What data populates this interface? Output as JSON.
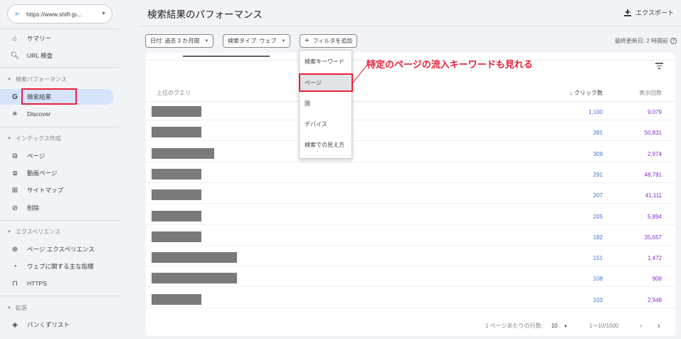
{
  "sidebar": {
    "property": "https://www.shift-jp...",
    "items": [
      {
        "label": "サマリー",
        "icon": "home-icon"
      },
      {
        "label": "URL 検査",
        "icon": "search-icon"
      },
      {
        "label": "検索結果",
        "icon": "google-g-icon"
      },
      {
        "label": "Discover",
        "icon": "asterisk-icon"
      },
      {
        "label": "ページ",
        "icon": "pages-icon"
      },
      {
        "label": "動画ページ",
        "icon": "video-pages-icon"
      },
      {
        "label": "サイトマップ",
        "icon": "sitemap-icon"
      },
      {
        "label": "削除",
        "icon": "eye-off-icon"
      },
      {
        "label": "ページ エクスペリエンス",
        "icon": "plus-circle-icon"
      },
      {
        "label": "ウェブに関する主な指標",
        "icon": "gauge-icon"
      },
      {
        "label": "HTTPS",
        "icon": "lock-icon"
      },
      {
        "label": "パンくずリスト",
        "icon": "diamond-icon"
      }
    ],
    "sections": [
      "検索パフォーマンス",
      "インデックス作成",
      "エクスペリエンス",
      "拡張"
    ]
  },
  "header": {
    "title": "検索結果のパフォーマンス",
    "export": "エクスポート"
  },
  "filters": {
    "date": "日付: 過去 3 か月間",
    "search_type": "検索タイプ: ウェブ",
    "add_filter": "フィルタを追加",
    "last_updated": "最終更新日: 2 時間前"
  },
  "dropdown": {
    "items": [
      "検索キーワード",
      "ページ",
      "国",
      "デバイス",
      "検索での見え方"
    ]
  },
  "annotation": "特定のページの流入キーワードも見れる",
  "table": {
    "columns": {
      "query": "上位のクエリ",
      "clicks": "クリック数",
      "impressions": "表示回数"
    },
    "rows": [
      {
        "clicks": "1,100",
        "impressions": "9,079"
      },
      {
        "clicks": "391",
        "impressions": "50,831"
      },
      {
        "clicks": "309",
        "impressions": "2,974"
      },
      {
        "clicks": "291",
        "impressions": "48,781"
      },
      {
        "clicks": "207",
        "impressions": "41,111"
      },
      {
        "clicks": "205",
        "impressions": "5,894"
      },
      {
        "clicks": "182",
        "impressions": "35,657"
      },
      {
        "clicks": "151",
        "impressions": "1,472"
      },
      {
        "clicks": "108",
        "impressions": "908"
      },
      {
        "clicks": "103",
        "impressions": "2,948"
      }
    ]
  },
  "pagination": {
    "rows_label": "1 ページあたりの行数:",
    "rows_value": "10",
    "range": "1～10/1000"
  },
  "colors": {
    "accent_red": "#e8203a",
    "clicks": "#4372c4",
    "impressions": "#8430ce",
    "active_nav": "#d6e4fb"
  }
}
